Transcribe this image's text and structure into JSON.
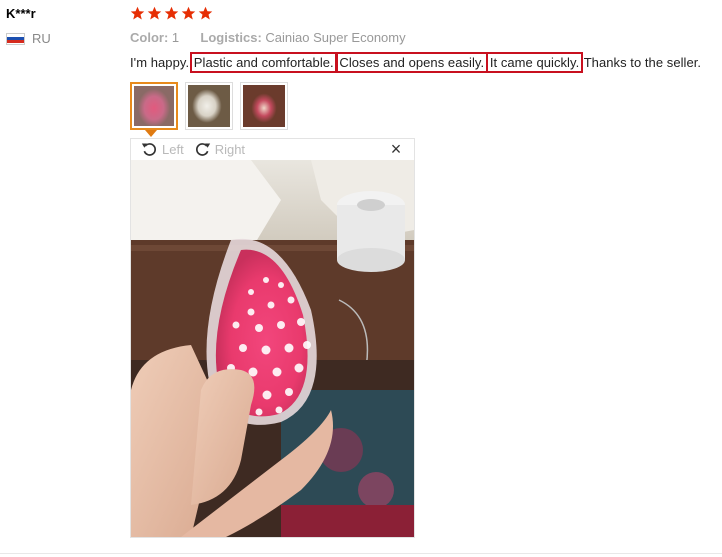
{
  "review": {
    "username": "K***r",
    "country": "RU",
    "rating": 5,
    "color_label": "Color:",
    "color_value": "1",
    "logistics_label": "Logistics:",
    "logistics_value": "Cainiao Super Economy",
    "text": {
      "t0": "I'm happy.",
      "h1": "Plastic and comfortable.",
      "h2": "Closes and opens easily.",
      "h3": "It came quickly.",
      "t4": "Thanks to the seller."
    }
  },
  "viewer": {
    "rotate_left_label": "Left",
    "rotate_right_label": "Right",
    "close_symbol": "×"
  },
  "colors": {
    "star": "#e62e04",
    "highlight_box": "#c8101f",
    "active_thumb": "#e88a1c"
  },
  "icons": [
    "star-icon",
    "rotate-left-icon",
    "rotate-right-icon",
    "close-icon",
    "flag-ru-icon"
  ]
}
